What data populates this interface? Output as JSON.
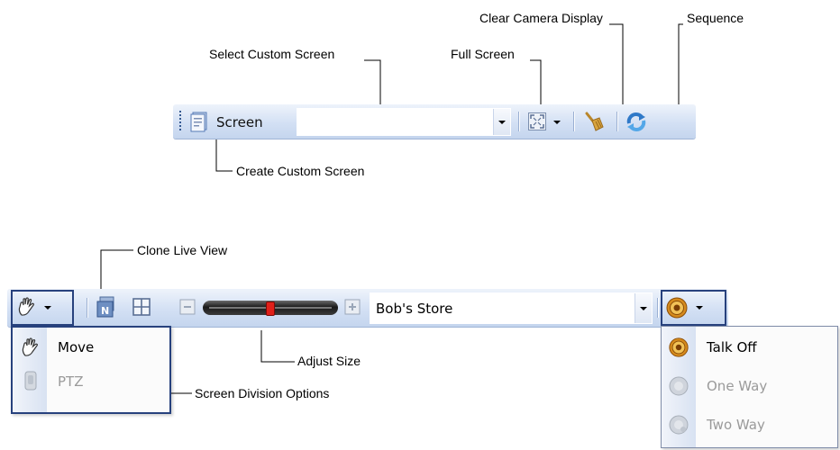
{
  "callouts": {
    "select_custom_screen": "Select Custom Screen",
    "full_screen": "Full Screen",
    "clear_camera_display": "Clear Camera Display",
    "sequence": "Sequence",
    "create_custom_screen": "Create Custom Screen",
    "clone_live_view": "Clone Live View",
    "adjust_size": "Adjust Size",
    "screen_division_options": "Screen Division Options"
  },
  "screen_toolbar": {
    "screen_label": "Screen",
    "custom_screen_value": ""
  },
  "live_toolbar": {
    "store_value": "Bob's Store",
    "size_slider_level": 0.5
  },
  "mode_menu": {
    "items": [
      {
        "label": "Move",
        "enabled": true
      },
      {
        "label": "PTZ",
        "enabled": false
      }
    ]
  },
  "talk_menu": {
    "items": [
      {
        "label": "Talk Off",
        "enabled": true
      },
      {
        "label": "One Way",
        "enabled": false
      },
      {
        "label": "Two Way",
        "enabled": false
      }
    ]
  },
  "colors": {
    "toolbar_light": "#eef3fb",
    "toolbar_dark": "#c4d5ee",
    "frame_border": "#27417d",
    "slider_thumb": "#e0201a"
  }
}
